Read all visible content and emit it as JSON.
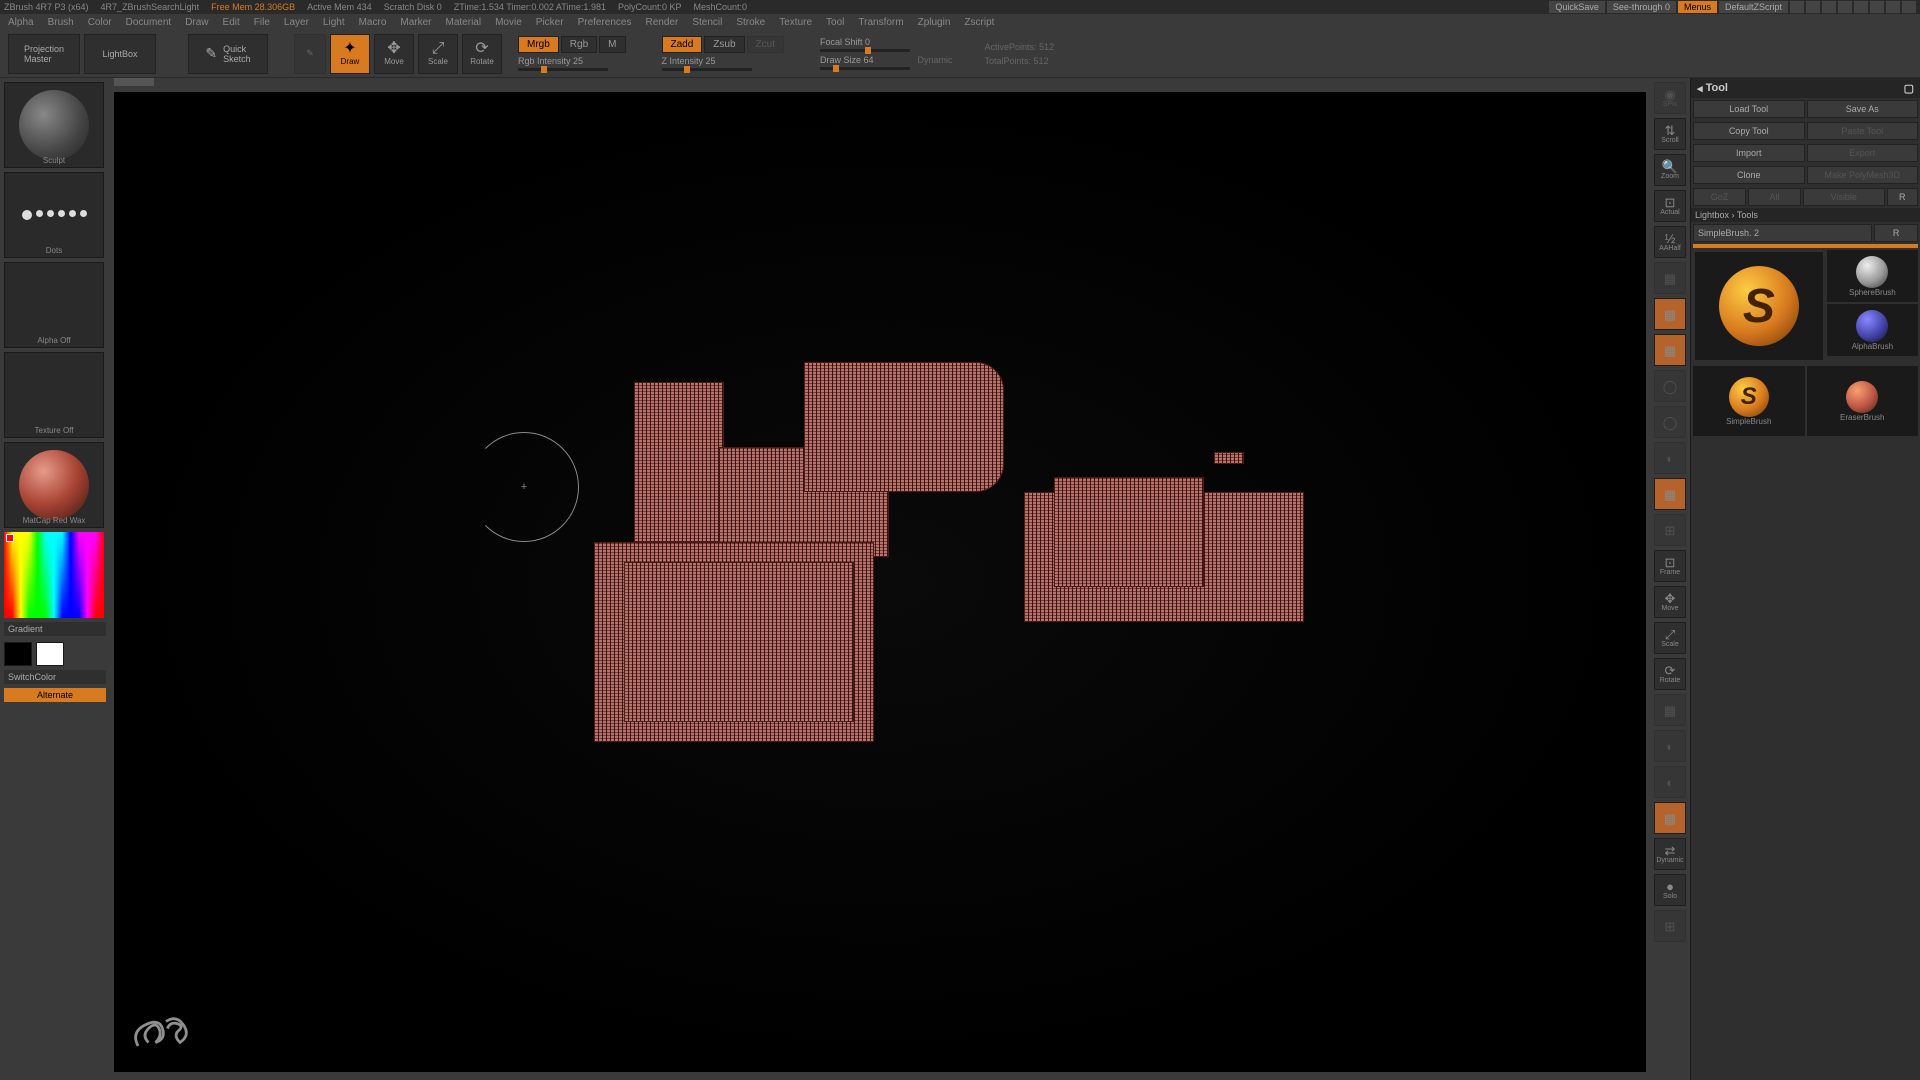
{
  "title": {
    "app": "ZBrush 4R7 P3 (x64)",
    "doc": "4R7_ZBrushSearchLight",
    "mem": "Free Mem 28.306GB",
    "amem": "Active Mem 434",
    "scratch": "Scratch Disk 0",
    "ztime": "ZTime:1.534  Timer:0.002  ATime:1.981",
    "poly": "PolyCount:0  KP",
    "mesh": "MeshCount:0",
    "quicksave": "QuickSave",
    "seethrough": "See-through  0",
    "menus": "Menus",
    "script": "DefaultZScript"
  },
  "menu": [
    "Alpha",
    "Brush",
    "Color",
    "Document",
    "Draw",
    "Edit",
    "File",
    "Layer",
    "Light",
    "Macro",
    "Marker",
    "Material",
    "Movie",
    "Picker",
    "Preferences",
    "Render",
    "Stencil",
    "Stroke",
    "Texture",
    "Tool",
    "Transform",
    "Zplugin",
    "Zscript"
  ],
  "toolbar": {
    "projection": "Projection\nMaster",
    "lightbox": "LightBox",
    "quicksketch": "Quick\nSketch",
    "modes": {
      "draw": "Draw",
      "move": "Move",
      "scale": "Scale",
      "rotate": "Rotate"
    },
    "mrgb": "Mrgb",
    "rgb": "Rgb",
    "m": "M",
    "rgb_int": "Rgb Intensity 25",
    "zadd": "Zadd",
    "zsub": "Zsub",
    "zcut": "Zcut",
    "z_int": "Z Intensity 25",
    "focal": "Focal Shift 0",
    "drawsize": "Draw Size 64",
    "dynamic": "Dynamic",
    "active": "ActivePoints: 512",
    "total": "TotalPoints: 512"
  },
  "left": {
    "brush": "Sculpt",
    "stroke": "Dots",
    "alpha": "Alpha Off",
    "texture": "Texture Off",
    "material": "MatCap Red Wax",
    "gradient": "Gradient",
    "switch": "SwitchColor",
    "alternate": "Alternate"
  },
  "shelf": [
    "SPix",
    "Scroll",
    "Zoom",
    "Actual",
    "AAHalf",
    "",
    "",
    "",
    "",
    "",
    "",
    "",
    "",
    "Frame",
    "Move",
    "Scale",
    "Rotate",
    "",
    "",
    "",
    "",
    "Dynamic",
    "Solo",
    ""
  ],
  "panel": {
    "title": "Tool",
    "load": "Load Tool",
    "save": "Save As",
    "copy": "Copy Tool",
    "paste": "Paste Tool",
    "import": "Import",
    "export": "Export",
    "clone": "Clone",
    "makepm": "Make PolyMesh3D",
    "gaz": "GoZ",
    "all": "All",
    "visible": "Visible",
    "r": "R",
    "lightbox": "Lightbox › Tools",
    "current": "SimpleBrush. 2",
    "tools": [
      "SimpleBrush",
      "SphereBrush",
      "AlphaBrush",
      "SimpleBrush",
      "EraserBrush"
    ]
  }
}
